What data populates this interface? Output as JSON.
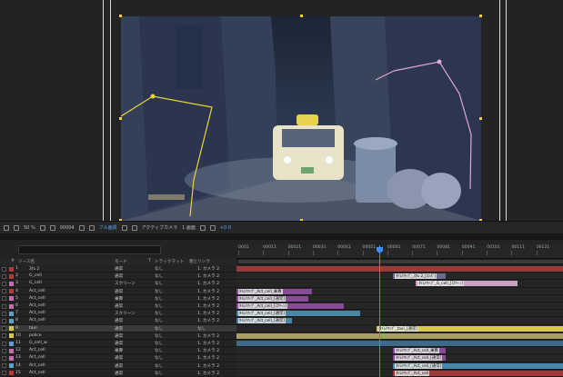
{
  "viewer": {
    "zoom": "50 %",
    "timecode": "00004",
    "resolution": "フル画質",
    "view": "アクティブカメラ",
    "views": "1 画面",
    "exposure": "+0.0",
    "plate_text": "4卍 2"
  },
  "timeline": {
    "search_placeholder": "",
    "columns": [
      "#",
      "ソース名",
      "モード",
      "T",
      "トラックマット",
      "親とリンク"
    ],
    "ruler": [
      "0001",
      "00011",
      "00021",
      "00031",
      "00041",
      "00051",
      "00061",
      "00071",
      "00081",
      "00091",
      "00101",
      "00111",
      "00121"
    ]
  },
  "layers": [
    {
      "num": "1",
      "name": "ｽﾀﾑ 2",
      "mode": "通常",
      "matte": "なし",
      "parent": "1. カメラ 2",
      "label": "#b23a3a"
    },
    {
      "num": "2",
      "name": "G_cell",
      "mode": "通常",
      "matte": "なし",
      "parent": "1. カメラ 2",
      "label": "#b23a3a"
    },
    {
      "num": "3",
      "name": "G_cell",
      "mode": "スクリーン",
      "matte": "なし",
      "parent": "1. カメラ 2",
      "label": "#c86cb0"
    },
    {
      "num": "4",
      "name": "Act_cell",
      "mode": "通常",
      "matte": "なし",
      "parent": "1. カメラ 2",
      "label": "#b23a3a"
    },
    {
      "num": "5",
      "name": "Act_cell",
      "mode": "乗算",
      "matte": "なし",
      "parent": "1. カメラ 2",
      "label": "#c86cb0"
    },
    {
      "num": "6",
      "name": "Act_cell",
      "mode": "通常",
      "matte": "なし",
      "parent": "1. カメラ 2",
      "label": "#c86cb0"
    },
    {
      "num": "7",
      "name": "Act_cell",
      "mode": "スクリーン",
      "matte": "なし",
      "parent": "1. カメラ 2",
      "label": "#5aa0c8"
    },
    {
      "num": "8",
      "name": "Act_cell",
      "mode": "通常",
      "matte": "なし",
      "parent": "1. カメラ 2",
      "label": "#5aa0c8"
    },
    {
      "num": "9",
      "name": "taxi",
      "mode": "通常",
      "matte": "なし",
      "parent": "なし",
      "label": "#d8c84a"
    },
    {
      "num": "10",
      "name": "police",
      "mode": "通常",
      "matte": "なし",
      "parent": "1. カメラ 2",
      "label": "#d8c84a"
    },
    {
      "num": "11",
      "name": "G_cell_w",
      "mode": "通常",
      "matte": "なし",
      "parent": "1. カメラ 2",
      "label": "#5aa0c8"
    },
    {
      "num": "12",
      "name": "Act_cell",
      "mode": "乗算",
      "matte": "なし",
      "parent": "1. カメラ 2",
      "label": "#c86cb0"
    },
    {
      "num": "13",
      "name": "Act_cell",
      "mode": "通常",
      "matte": "なし",
      "parent": "1. カメラ 2",
      "label": "#c86cb0"
    },
    {
      "num": "14",
      "name": "Act_cell",
      "mode": "通常",
      "matte": "なし",
      "parent": "1. カメラ 2",
      "label": "#5aa0c8"
    },
    {
      "num": "15",
      "name": "Act_cell",
      "mode": "通常",
      "matte": "なし",
      "parent": "1. カメラ 2",
      "label": "#b23a3a"
    }
  ],
  "tracks": [
    {
      "start": 0.0,
      "end": 1.0,
      "color": "#9a3a3a",
      "text": ""
    },
    {
      "start": 0.48,
      "end": 0.64,
      "color": "#6b6b8c",
      "text": "ﾀｲﾑﾘﾏｯﾌﾟ_ｽﾀﾑ 2_[ｺﾝﾎﾟ]"
    },
    {
      "start": 0.55,
      "end": 0.86,
      "color": "#c8a0c0",
      "text": "ﾀｲﾑﾘﾏｯﾌﾟ_G_cell_[ｽｸﾘｰﾝ]"
    },
    {
      "start": 0.0,
      "end": 0.23,
      "color": "#8a4a9a",
      "text": "ﾀｲﾑﾘﾏｯﾌﾟ_Act_cell_乗算"
    },
    {
      "start": 0.0,
      "end": 0.22,
      "color": "#8a4a9a",
      "text": "ﾀｲﾑﾘﾏｯﾌﾟ_Act_cell_[通常]"
    },
    {
      "start": 0.0,
      "end": 0.33,
      "color": "#8a4a9a",
      "text": "ﾀｲﾑﾘﾏｯﾌﾟ_Act_cell_[ｽｸﾘｰﾝ]"
    },
    {
      "start": 0.0,
      "end": 0.38,
      "color": "#4a86a8",
      "text": "ﾀｲﾑﾘﾏｯﾌﾟ_Act_cell_[通常]"
    },
    {
      "start": 0.0,
      "end": 0.17,
      "color": "#4a86a8",
      "text": "ﾀｲﾑﾘﾏｯﾌﾟ_Act_cell_[通常]"
    },
    {
      "start": 0.43,
      "end": 1.0,
      "color": "#d8c84a",
      "text": "ﾀｲﾑﾘﾏｯﾌﾟ_taxi_[通常]"
    },
    {
      "start": 0.0,
      "end": 1.0,
      "color": "#a8a060",
      "text": ""
    },
    {
      "start": 0.0,
      "end": 1.0,
      "color": "#3c6a88",
      "text": ""
    },
    {
      "start": 0.48,
      "end": 0.64,
      "color": "#8a4a9a",
      "text": "ﾀｲﾑﾘﾏｯﾌﾟ_Act_cell_乗算"
    },
    {
      "start": 0.48,
      "end": 0.64,
      "color": "#8a4a9a",
      "text": "ﾀｲﾑﾘﾏｯﾌﾟ_Act_cell_[通常]"
    },
    {
      "start": 0.48,
      "end": 1.0,
      "color": "#4a86a8",
      "text": "ﾀｲﾑﾘﾏｯﾌﾟ_Act_cell_[通常]"
    },
    {
      "start": 0.48,
      "end": 1.0,
      "color": "#9a3a3a",
      "text": "ﾀｲﾑﾘﾏｯﾌﾟ_Act_cell"
    }
  ]
}
